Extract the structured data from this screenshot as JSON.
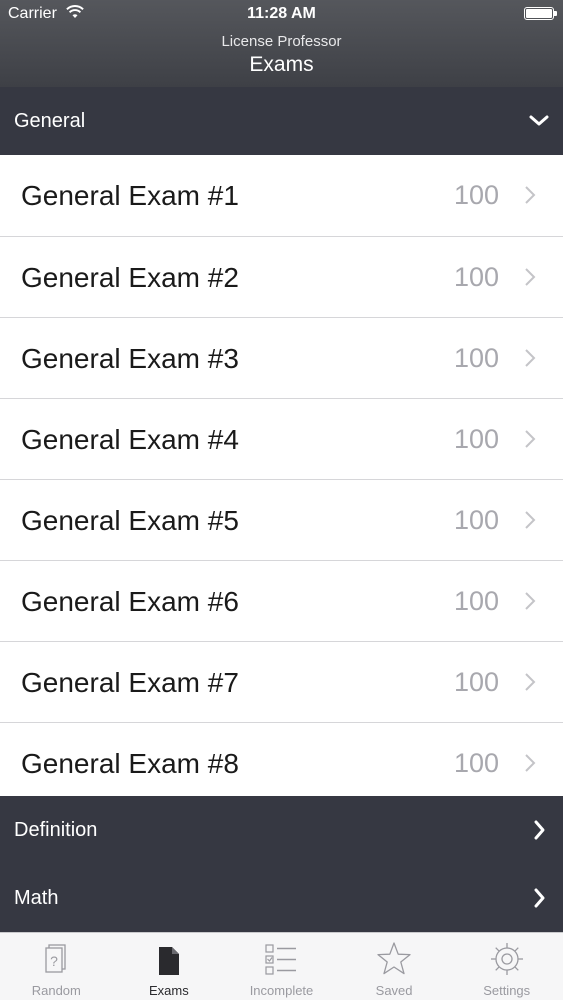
{
  "status_bar": {
    "carrier": "Carrier",
    "time": "11:28 AM"
  },
  "nav": {
    "subtitle": "License Professor",
    "title": "Exams"
  },
  "sections": [
    {
      "label": "General",
      "expanded": true
    },
    {
      "label": "Definition",
      "expanded": false
    },
    {
      "label": "Math",
      "expanded": false
    }
  ],
  "exams": [
    {
      "label": "General Exam #1",
      "count": "100"
    },
    {
      "label": "General Exam #2",
      "count": "100"
    },
    {
      "label": "General Exam #3",
      "count": "100"
    },
    {
      "label": "General Exam #4",
      "count": "100"
    },
    {
      "label": "General Exam #5",
      "count": "100"
    },
    {
      "label": "General Exam #6",
      "count": "100"
    },
    {
      "label": "General Exam #7",
      "count": "100"
    },
    {
      "label": "General Exam #8",
      "count": "100"
    }
  ],
  "tabs": [
    {
      "label": "Random",
      "icon": "random-card-icon"
    },
    {
      "label": "Exams",
      "icon": "document-icon",
      "active": true
    },
    {
      "label": "Incomplete",
      "icon": "checklist-icon"
    },
    {
      "label": "Saved",
      "icon": "star-icon"
    },
    {
      "label": "Settings",
      "icon": "gear-icon"
    }
  ],
  "colors": {
    "header_bg": "#3e4046",
    "section_bg": "#363842",
    "count_text": "#a8a8ae",
    "tab_inactive": "#9a9aa0"
  }
}
